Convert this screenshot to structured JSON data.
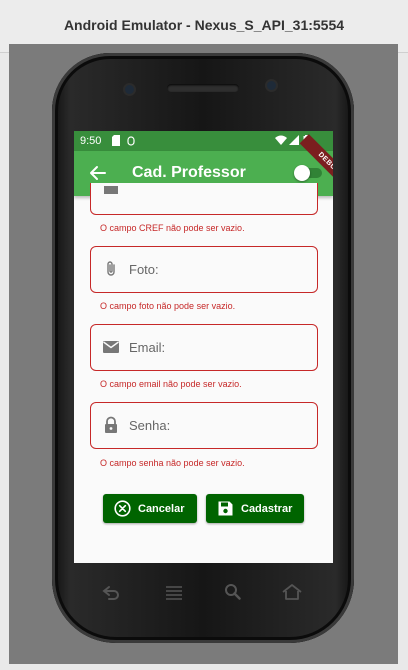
{
  "window": {
    "title": "Android Emulator - Nexus_S_API_31:5554"
  },
  "status_bar": {
    "time": "9:50"
  },
  "app_bar": {
    "title": "Cad. Professor",
    "debug_banner": "DEBUG"
  },
  "form": {
    "fields": [
      {
        "label": "",
        "error": "O campo CREF não pode ser vazio.",
        "icon": "badge-icon"
      },
      {
        "label": "Foto:",
        "error": "O campo foto não pode ser vazio.",
        "icon": "attachment-icon"
      },
      {
        "label": "Email:",
        "error": "O campo email não pode ser vazio.",
        "icon": "email-icon"
      },
      {
        "label": "Senha:",
        "error": "O campo senha não pode ser vazio.",
        "icon": "lock-icon"
      }
    ]
  },
  "buttons": {
    "cancel_label": "Cancelar",
    "submit_label": "Cadastrar"
  },
  "colors": {
    "primary": "#4caf50",
    "status_bar": "#388e3c",
    "error": "#c62828",
    "button": "#006400"
  }
}
